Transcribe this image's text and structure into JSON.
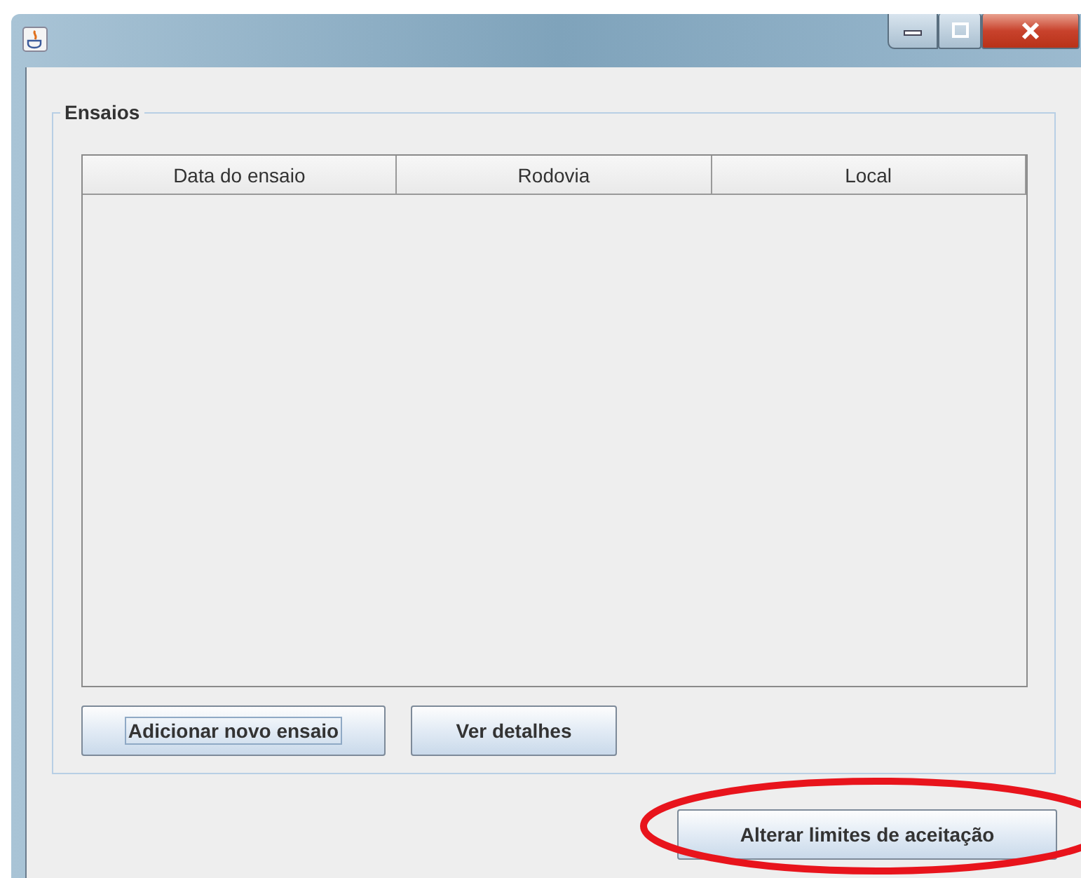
{
  "window": {
    "controls": [
      {
        "kind": "minimize"
      },
      {
        "kind": "maximize"
      },
      {
        "kind": "close"
      }
    ]
  },
  "panel": {
    "title": "Ensaios",
    "table": {
      "columns": [
        "Data do ensaio",
        "Rodovia",
        "Local"
      ]
    },
    "buttons": [
      {
        "label": "Adicionar novo ensaio",
        "focused": true
      },
      {
        "label": "Ver detalhes",
        "focused": false
      }
    ]
  },
  "footer_button": {
    "label": "Alterar limites de aceitação",
    "highlighted": true
  }
}
